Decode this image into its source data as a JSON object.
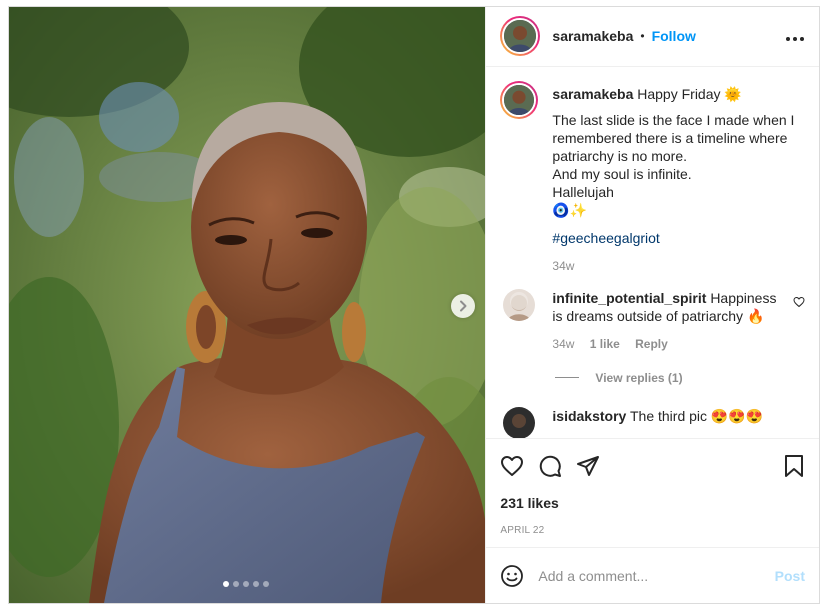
{
  "header": {
    "username": "saramakeba",
    "separator": "•",
    "follow_label": "Follow",
    "more_icon": "more-horizontal-icon"
  },
  "caption": {
    "username": "saramakeba",
    "first_line": "Happy Friday",
    "sun_emoji": "🌞",
    "text": "The last slide is the face I made when I remembered there is a timeline where patriarchy is no more.\nAnd my soul is infinite.\nHallelujah",
    "emojis": "🧿✨",
    "hashtag": "#geecheegalgriot",
    "time": "34w"
  },
  "comments": [
    {
      "username": "infinite_potential_spirit",
      "text": "Happiness is dreams outside of patriarchy",
      "emoji": "🔥",
      "time": "34w",
      "likes": "1 like",
      "reply_label": "Reply",
      "view_replies": "View replies (1)"
    },
    {
      "username": "isidakstory",
      "text": "The third pic",
      "emoji": "😍😍😍"
    }
  ],
  "actions": {
    "likes": "231 likes",
    "date": "APRIL 22"
  },
  "add_comment": {
    "placeholder": "Add a comment...",
    "post_label": "Post"
  },
  "carousel": {
    "slide_count": 5,
    "active_slide": 1
  },
  "colors": {
    "accent": "#0095f6",
    "post_disabled": "#b2dffc",
    "hashtag": "#00376b",
    "muted": "#8e8e8e"
  }
}
